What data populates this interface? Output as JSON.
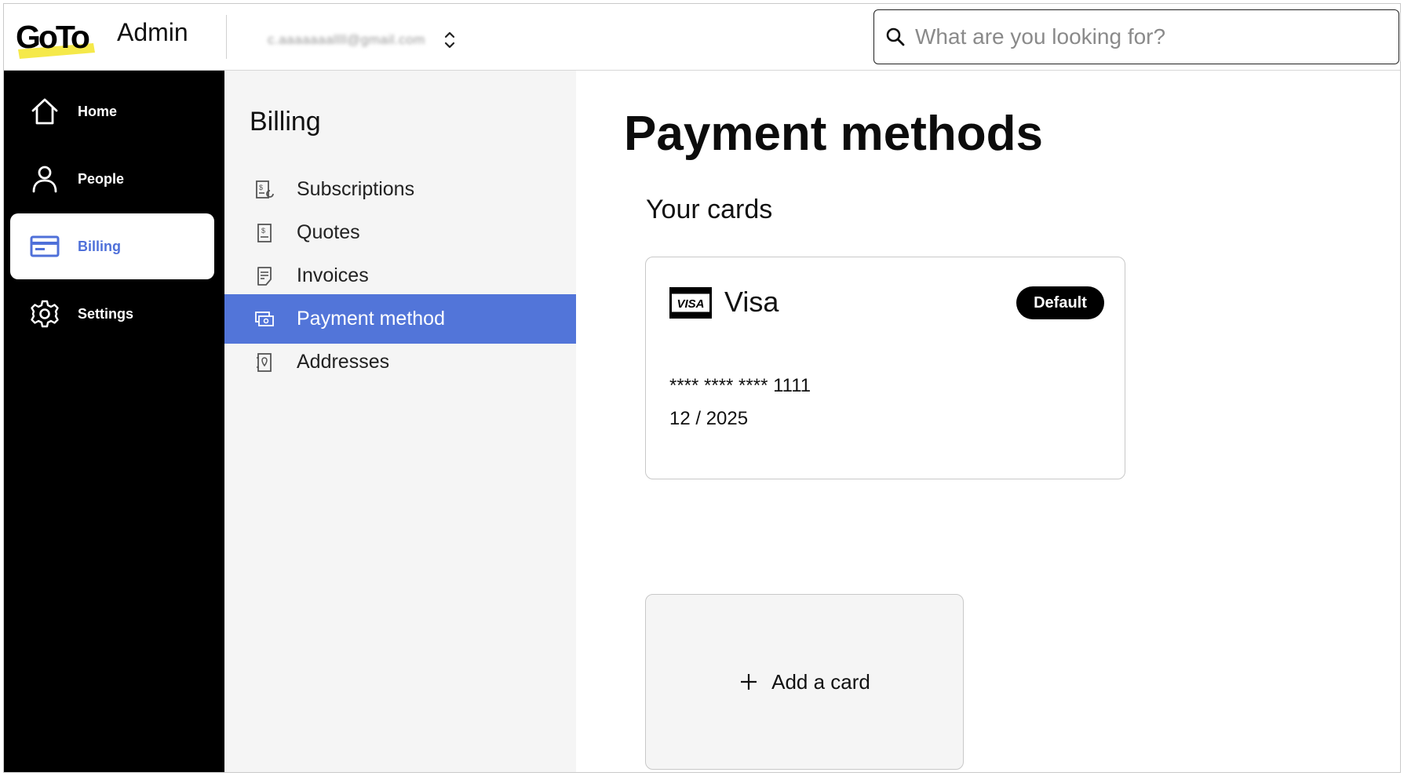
{
  "header": {
    "logo_text": "GoTo",
    "app_label": "Admin",
    "account_name": "c.aaaaaaallll@gmail.com",
    "search_placeholder": "What are you looking for?"
  },
  "leftnav": {
    "items": [
      {
        "label": "Home",
        "icon": "home-icon"
      },
      {
        "label": "People",
        "icon": "person-icon"
      },
      {
        "label": "Billing",
        "icon": "billing-icon",
        "active": true
      },
      {
        "label": "Settings",
        "icon": "gear-icon"
      }
    ]
  },
  "subnav": {
    "title": "Billing",
    "items": [
      {
        "label": "Subscriptions",
        "icon": "subscriptions-icon"
      },
      {
        "label": "Quotes",
        "icon": "quotes-icon"
      },
      {
        "label": "Invoices",
        "icon": "invoices-icon"
      },
      {
        "label": "Payment method",
        "icon": "payment-method-icon",
        "active": true
      },
      {
        "label": "Addresses",
        "icon": "addresses-icon"
      }
    ]
  },
  "main": {
    "title": "Payment methods",
    "section_title": "Your cards",
    "card": {
      "logo_text": "VISA",
      "brand": "Visa",
      "badge": "Default",
      "number": "**** **** **** 1111",
      "expiry": "12 / 2025"
    },
    "add_card_label": "Add a card"
  },
  "colors": {
    "accent": "#5275d9",
    "logo_highlight": "#f5e94a",
    "nav_bg": "#000000",
    "subnav_bg": "#f5f5f5"
  }
}
